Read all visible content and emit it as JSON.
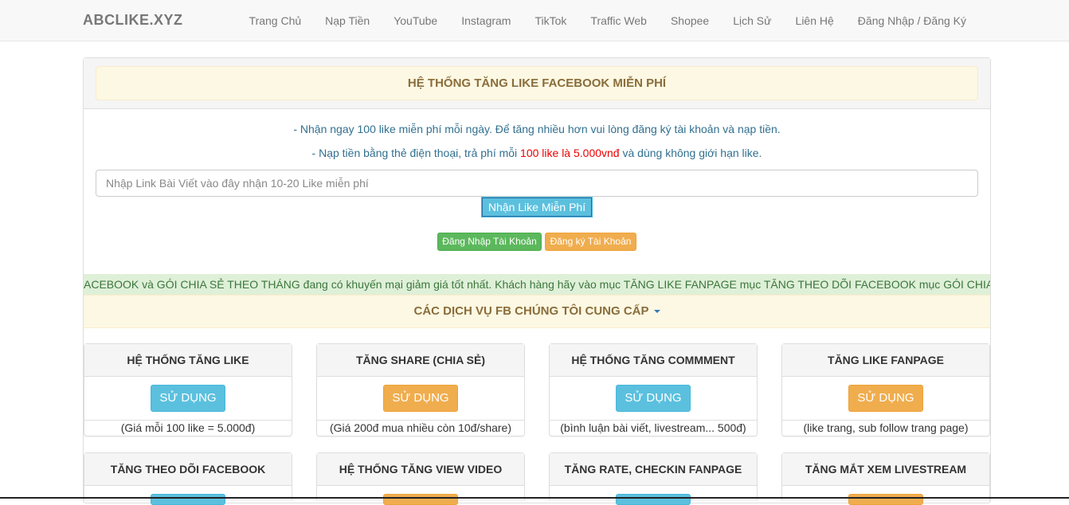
{
  "navbar": {
    "brand": "ABCLIKE.XYZ",
    "items": [
      "Trang Chủ",
      "Nạp Tiền",
      "YouTube",
      "Instagram",
      "TikTok",
      "Traffic Web",
      "Shopee",
      "Lịch Sử",
      "Liên Hệ",
      "Đăng Nhập / Đăng Ký"
    ]
  },
  "main": {
    "title": "HỆ THỐNG TĂNG LIKE FACEBOOK MIỄN PHÍ",
    "info_line1": "- Nhận ngay 100 like miễn phí mỗi ngày. Để tăng nhiều hơn vui lòng đăng ký tài khoản và nạp tiền.",
    "info_line2_prefix": "- Nạp tiền bằng thẻ điện thoại, trả phí mỗi ",
    "info_line2_highlight": "100 like là 5.000vnđ",
    "info_line2_suffix": " và dùng không giới hạn like.",
    "link_placeholder": "Nhập Link Bài Viết vào đây nhận 10-20 Like miễn phí",
    "free_like_button": "Nhận Like Miễn Phí",
    "login_button": "Đăng Nhập Tài Khoản",
    "register_button": "Đăng ký Tài Khoản",
    "marquee_text": "ACEBOOK và GÓI CHIA SẺ THEO THÁNG đang có khuyến mại giảm giá tốt nhất. Khách hàng hãy vào mục TĂNG LIKE FANPAGE mục TĂNG THEO DÕI FACEBOOK mục GÓI CHIA",
    "services_heading": "CÁC DỊCH VỤ FB CHÚNG TÔI CUNG CẤP"
  },
  "services": [
    {
      "title": "HỆ THỐNG TĂNG LIKE",
      "button": "SỬ DỤNG",
      "note": "(Giá mỗi 100 like = 5.000đ)"
    },
    {
      "title": "TĂNG SHARE (CHIA SẺ)",
      "button": "SỬ DỤNG",
      "note": "(Giá 200đ mua nhiều còn 10đ/share)"
    },
    {
      "title": "HỆ THỐNG TĂNG COMMMENT",
      "button": "SỬ DỤNG",
      "note": "(bình luận bài viết, livestream... 500đ)"
    },
    {
      "title": "TĂNG LIKE FANPAGE",
      "button": "SỬ DỤNG",
      "note": "(like trang, sub follow trang page)"
    },
    {
      "title": "TĂNG THEO DÕI FACEBOOK"
    },
    {
      "title": "HỆ THỐNG TĂNG VIEW VIDEO"
    },
    {
      "title": "TĂNG RATE, CHECKIN FANPAGE"
    },
    {
      "title": "TĂNG MẮT XEM LIVESTREAM"
    }
  ],
  "colors": {
    "info_button": "#5bc0de",
    "warning_button": "#f0ad4e",
    "success_button": "#5cb85c",
    "alert_background": "#fcf8e3",
    "marquee_background": "#dff0d8",
    "price_highlight": "#ee0000"
  }
}
